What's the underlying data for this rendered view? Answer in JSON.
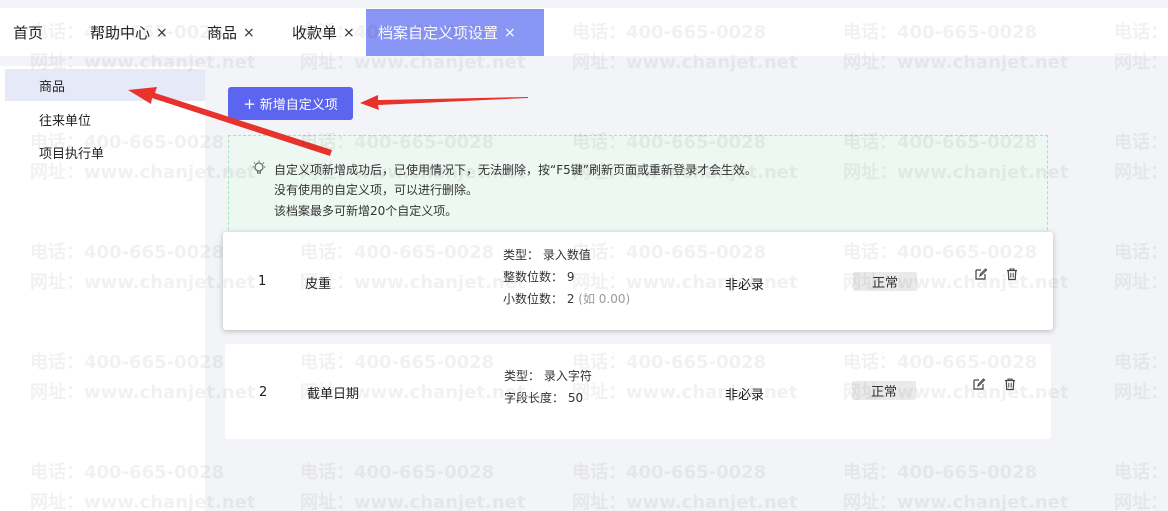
{
  "tabs": [
    {
      "label": "首页",
      "closable": false,
      "active": false
    },
    {
      "label": "帮助中心",
      "closable": true,
      "active": false
    },
    {
      "label": "商品",
      "closable": true,
      "active": false
    },
    {
      "label": "收款单",
      "closable": true,
      "active": false
    },
    {
      "label": "档案自定义项设置",
      "closable": true,
      "active": true
    }
  ],
  "close_glyph": "×",
  "sidebar": {
    "items": [
      {
        "label": "商品",
        "active": true
      },
      {
        "label": "往来单位",
        "active": false
      },
      {
        "label": "项目执行单",
        "active": false
      }
    ]
  },
  "toolbar": {
    "add_label": "新增自定义项",
    "add_icon": "+"
  },
  "notice": {
    "icon": "lightbulb-icon",
    "lines": [
      "自定义项新增成功后，已使用情况下，无法删除，按“F5键”刷新页面或重新登录才会生效。",
      "没有使用的自定义项，可以进行删除。",
      "该档案最多可新增20个自定义项。"
    ]
  },
  "items": [
    {
      "index": "1",
      "name": "皮重",
      "type_line": "类型： 录入数值",
      "details": [
        "整数位数： 9",
        "小数位数： 2"
      ],
      "example": "(如 0.00)",
      "required": "非必录",
      "status": "正常"
    },
    {
      "index": "2",
      "name": "截单日期",
      "type_line": "类型： 录入字符",
      "details": [
        "字段长度： 50"
      ],
      "required": "非必录",
      "status": "正常"
    }
  ],
  "watermark": {
    "phone": "电话：400-665-0028",
    "site": "网址：www.chanjet.net"
  },
  "colors": {
    "accent": "#5b65f0",
    "active_tab": "#8a96f6",
    "arrow": "#e8322c",
    "notice_border": "#a5e3bd"
  }
}
